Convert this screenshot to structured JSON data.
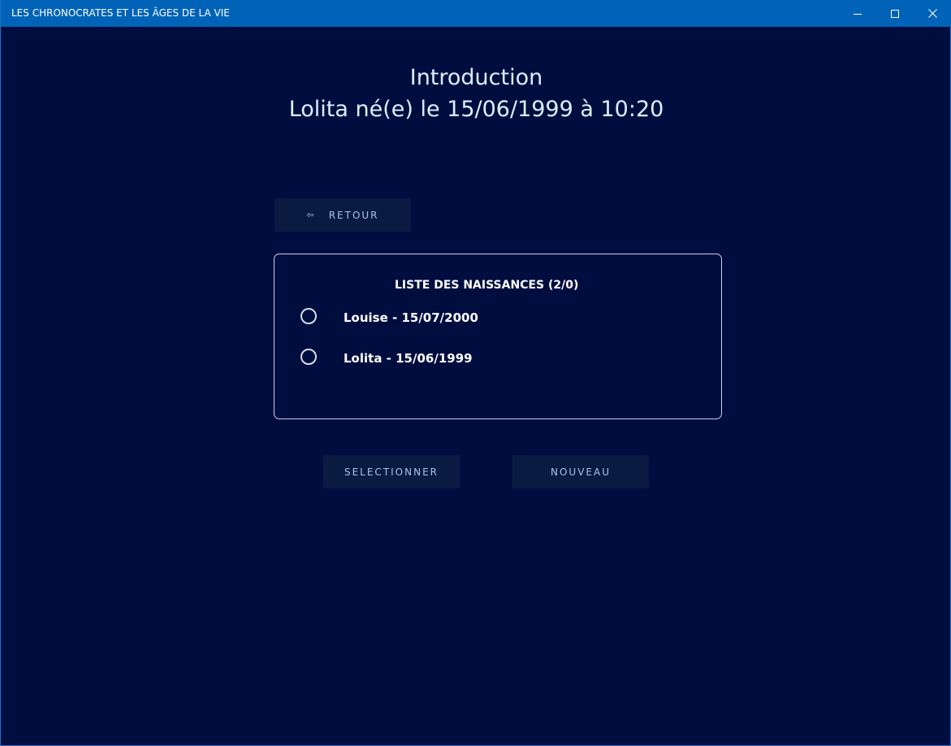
{
  "window": {
    "title": "LES CHRONOCRATES ET LES ÂGES DE LA VIE"
  },
  "header": {
    "line1": "Introduction",
    "line2": "Lolita né(e) le 15/06/1999 à 10:20"
  },
  "back_button": {
    "icon": "⇦",
    "label": "RETOUR"
  },
  "birth_list": {
    "title": "LISTE DES NAISSANCES (2/0)",
    "items": [
      {
        "label": "Louise - 15/07/2000",
        "selected": false
      },
      {
        "label": "Lolita - 15/06/1999",
        "selected": false
      }
    ]
  },
  "actions": {
    "select_label": "SELECTIONNER",
    "new_label": "NOUVEAU"
  },
  "colors": {
    "titlebar": "#0063b7",
    "background": "#000d3f",
    "button_bg": "#0a1b42",
    "button_text": "#a9c2df",
    "heading_text": "#d9f0ff"
  }
}
